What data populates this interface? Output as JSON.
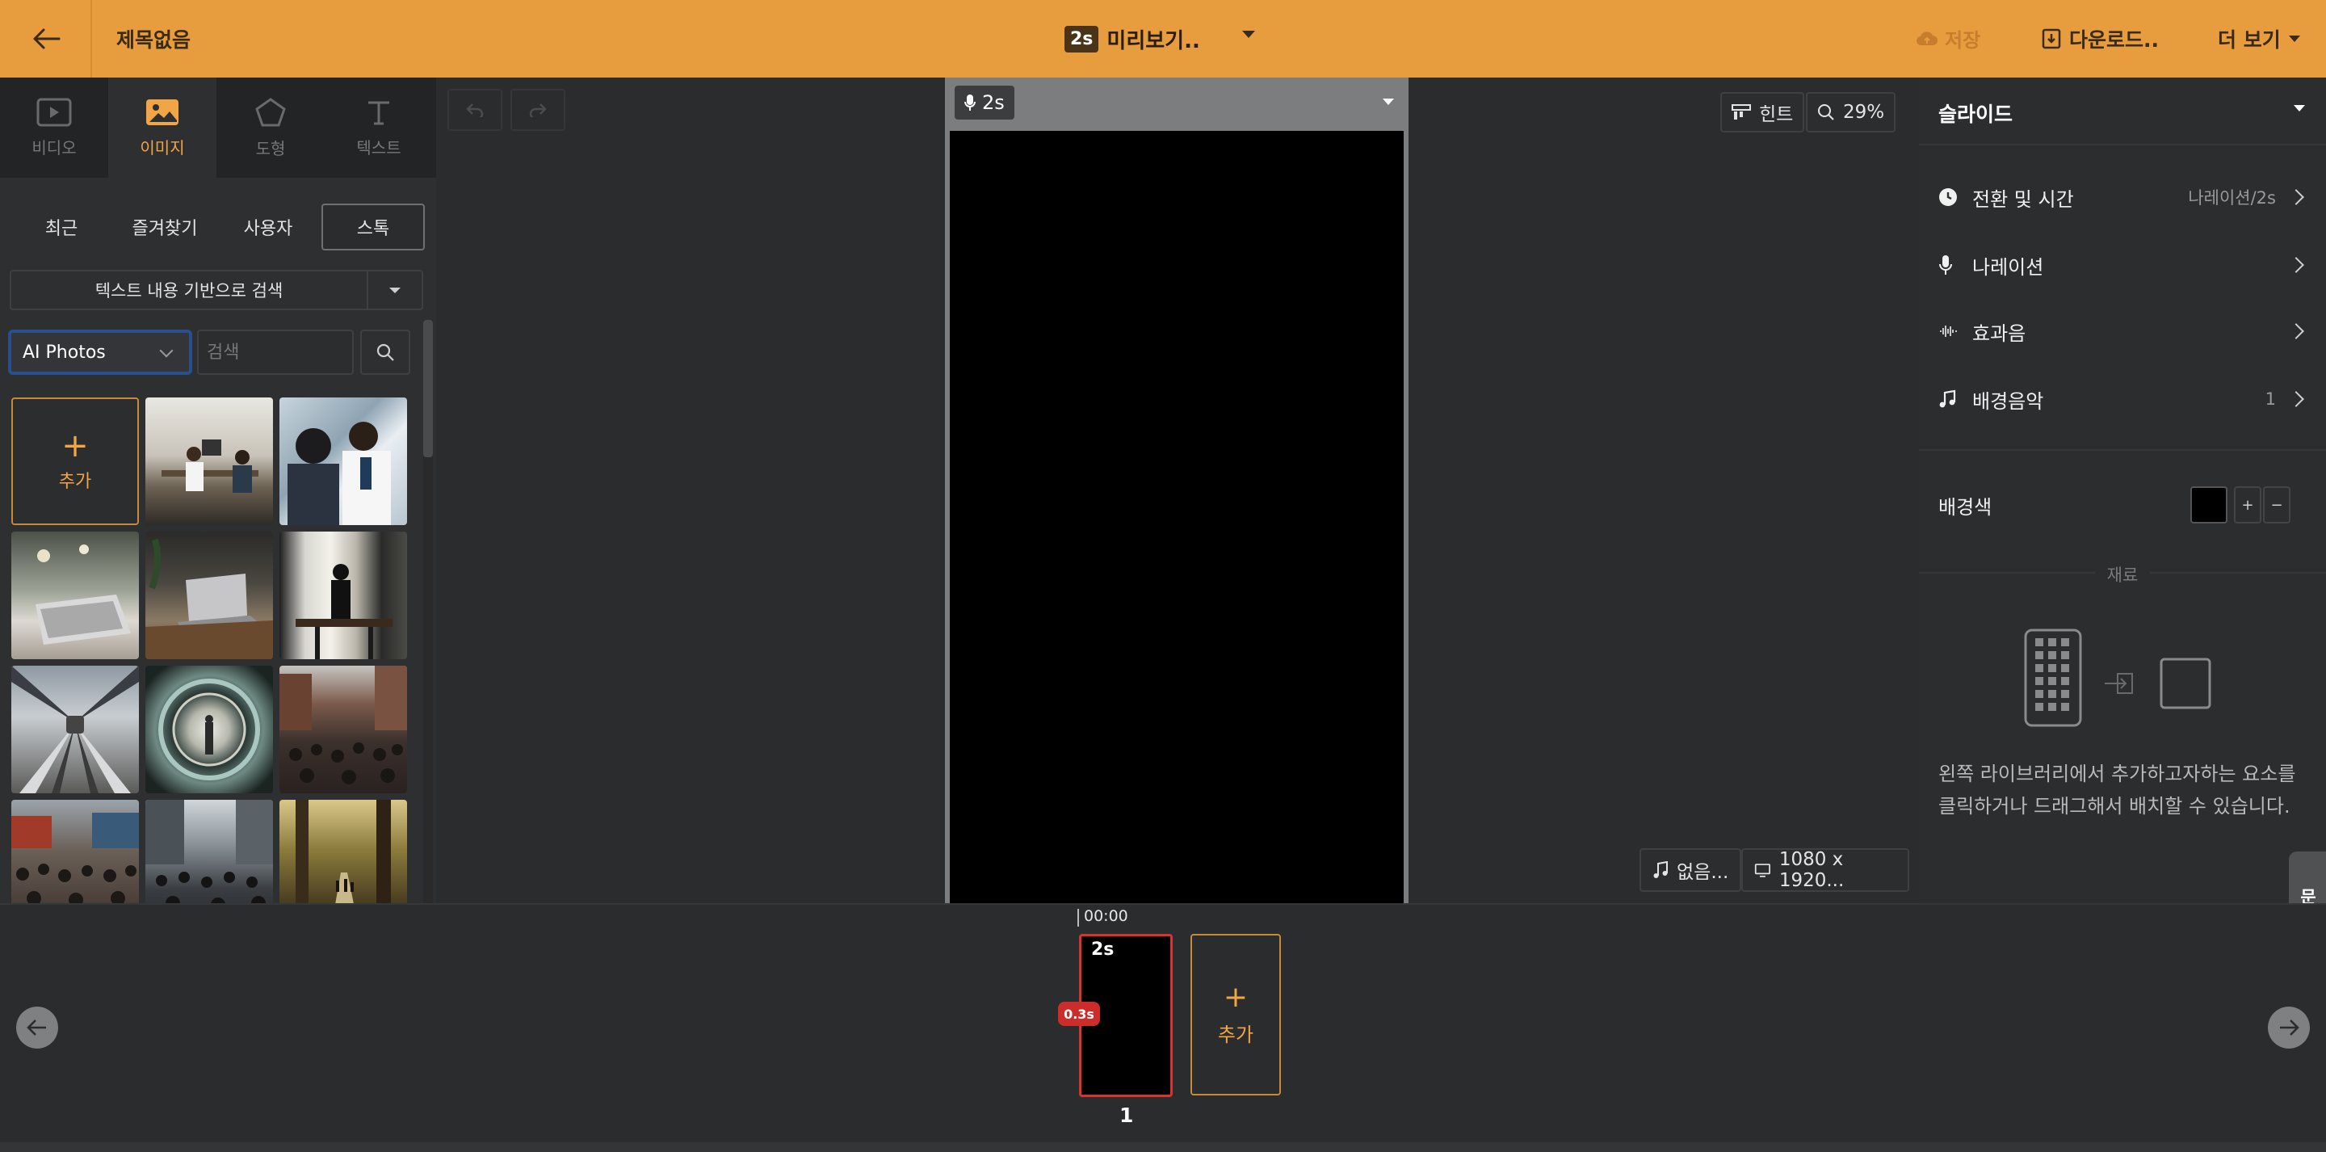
{
  "header": {
    "title": "제목없음",
    "preview_badge": "2s",
    "preview_label": "미리보기..",
    "save_label": "저장",
    "download_label": "다운로드..",
    "more_label": "더 보기"
  },
  "left_panel": {
    "tabs": [
      {
        "label": "비디오",
        "icon": "video-icon"
      },
      {
        "label": "이미지",
        "icon": "image-icon"
      },
      {
        "label": "도형",
        "icon": "shape-icon"
      },
      {
        "label": "텍스트",
        "icon": "text-icon"
      }
    ],
    "active_tab": "이미지",
    "subtabs": [
      "최근",
      "즐겨찾기",
      "사용자",
      "스톡"
    ],
    "active_subtab": "스톡",
    "text_search_label": "텍스트 내용 기반으로 검색",
    "source_select": "AI Photos",
    "search_placeholder": "검색",
    "add_label": "추가",
    "thumbnails": [
      "doctor-office-photo",
      "doctor-patient-photo",
      "laptop-desk-photo",
      "laptop-window-photo",
      "office-silhouette-photo",
      "train-tunnel-photo",
      "tunnel-portal-photo",
      "crowd-street-photo",
      "crowd-market-photo",
      "crowd-city-photo",
      "park-path-photo"
    ]
  },
  "canvas": {
    "slide_duration": "2s",
    "hint_label": "힌트",
    "zoom": "29%",
    "music_label": "없음...",
    "resolution": "1080 x 1920..."
  },
  "right_panel": {
    "title": "슬라이드",
    "rows": [
      {
        "label": "전환 및 시간",
        "value": "나레이션/2s",
        "icon": "clock-icon"
      },
      {
        "label": "나레이션",
        "value": "",
        "icon": "microphone-icon"
      },
      {
        "label": "효과음",
        "value": "",
        "icon": "waveform-icon"
      },
      {
        "label": "배경음악",
        "value": "1",
        "icon": "music-note-icon"
      }
    ],
    "bg_color_label": "배경색",
    "bg_color": "#000000",
    "material_label": "재료",
    "help_text": "왼쪽 라이브러리에서 추가하고자하는 요소를 클릭하거나 드래그해서 배치할 수 있습니다.",
    "inquiry_label": "문의"
  },
  "timeline": {
    "time": "00:00",
    "slide_duration": "2s",
    "transition": "0.3s",
    "slide_number": "1",
    "add_label": "추가"
  },
  "colors": {
    "accent": "#e79c3e",
    "accent_text": "#f1a545",
    "selection": "#d9332f"
  }
}
